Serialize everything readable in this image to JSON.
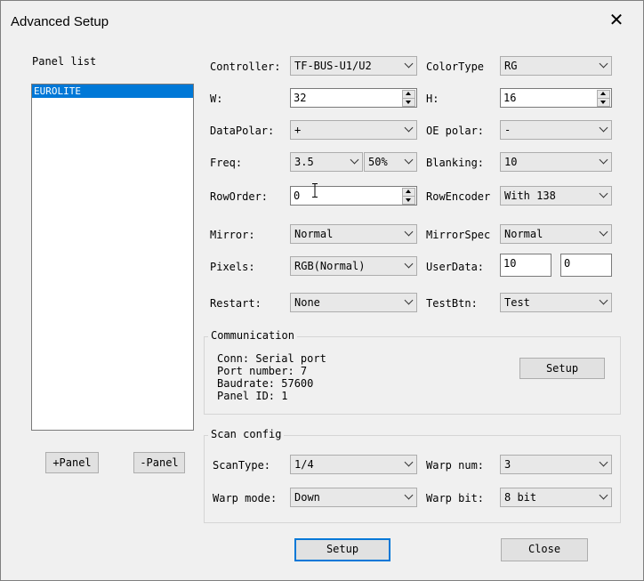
{
  "window": {
    "title": "Advanced Setup"
  },
  "panel_list": {
    "label": "Panel list",
    "items": [
      "EUROLITE"
    ],
    "add_label": "+Panel",
    "remove_label": "-Panel"
  },
  "fields": {
    "controller": {
      "label": "Controller:",
      "value": "TF-BUS-U1/U2"
    },
    "color_type": {
      "label": "ColorType",
      "value": "RG"
    },
    "w": {
      "label": "W:",
      "value": "32"
    },
    "h": {
      "label": "H:",
      "value": "16"
    },
    "data_polar": {
      "label": "DataPolar:",
      "value": "+"
    },
    "oe_polar": {
      "label": "OE polar:",
      "value": "-"
    },
    "freq": {
      "label": "Freq:",
      "value": "3.5",
      "duty": "50%"
    },
    "blanking": {
      "label": "Blanking:",
      "value": "10"
    },
    "row_order": {
      "label": "RowOrder:",
      "value": "0"
    },
    "row_encoder": {
      "label": "RowEncoder",
      "value": "With 138"
    },
    "mirror": {
      "label": "Mirror:",
      "value": "Normal"
    },
    "mirror_spec": {
      "label": "MirrorSpec",
      "value": "Normal"
    },
    "pixels": {
      "label": "Pixels:",
      "value": "RGB(Normal)"
    },
    "user_data": {
      "label": "UserData:",
      "value1": "10",
      "value2": "0"
    },
    "restart": {
      "label": "Restart:",
      "value": "None"
    },
    "test_btn": {
      "label": "TestBtn:",
      "value": "Test"
    }
  },
  "communication": {
    "legend": "Communication",
    "conn": "Conn: Serial port",
    "port": "Port number: 7",
    "baud": "Baudrate: 57600",
    "panel_id": "Panel ID: 1",
    "setup_label": "Setup"
  },
  "scan_config": {
    "legend": "Scan config",
    "scan_type": {
      "label": "ScanType:",
      "value": "1/4"
    },
    "warp_num": {
      "label": "Warp num:",
      "value": "3"
    },
    "warp_mode": {
      "label": "Warp mode:",
      "value": "Down"
    },
    "warp_bit": {
      "label": "Warp bit:",
      "value": "8 bit"
    }
  },
  "footer": {
    "setup_label": "Setup",
    "close_label": "Close"
  },
  "colors": {
    "accent": "#0078d7",
    "background": "#f0f0f0"
  }
}
